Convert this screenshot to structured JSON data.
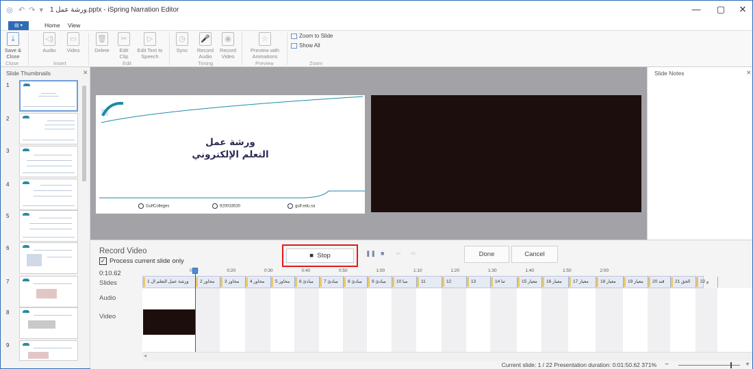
{
  "window": {
    "file_name": "ورشة عمل 1.pptx",
    "separator": "-",
    "app_name": "iSpring Narration Editor"
  },
  "ribbon_tabs": [
    "Home",
    "View"
  ],
  "ribbon": {
    "buttons": [
      {
        "label": "Save & Close",
        "icon": "save-close-icon"
      },
      {
        "label": "Audio",
        "icon": "audio-icon"
      },
      {
        "label": "Video",
        "icon": "video-icon"
      },
      {
        "label": "Delete",
        "icon": "delete-icon"
      },
      {
        "label": "Edit Clip",
        "icon": "edit-clip-icon"
      },
      {
        "label": "Edit Text to Speech",
        "icon": "text-to-speech-icon"
      },
      {
        "label": "Sync",
        "icon": "sync-icon"
      },
      {
        "label": "Record Audio",
        "icon": "record-audio-icon"
      },
      {
        "label": "Record Video",
        "icon": "record-video-icon"
      },
      {
        "label": "Preview with Animations",
        "icon": "preview-icon"
      }
    ],
    "groups": [
      "Close",
      "Insert",
      "Edit",
      "Timing",
      "Preview",
      "Zoom"
    ],
    "zoom_to_slide": "Zoom to Slide",
    "show_all": "Show All"
  },
  "thumbnails": {
    "header": "Slide Thumbnails",
    "numbers": [
      "1",
      "2",
      "3",
      "4",
      "5",
      "6",
      "7",
      "8",
      "9"
    ]
  },
  "slide": {
    "title_line1": "ورشة عمل",
    "title_line2": "التعلم الإلكتروني",
    "footer_social": "GulfColleges",
    "footer_phone": "920033530",
    "footer_web": "gulf.edu.sa"
  },
  "notes": {
    "header": "Slide Notes"
  },
  "record": {
    "title": "Record Video",
    "process_label": "Process current slide only",
    "process_checked": true,
    "stop_label": "Stop",
    "done_label": "Done",
    "cancel_label": "Cancel",
    "time": "0:10.62",
    "row_slides": "Slides",
    "row_audio": "Audio",
    "row_video": "Video"
  },
  "ruler_ticks": [
    "0:10",
    "0:20",
    "0:30",
    "0:40",
    "0:50",
    "1:00",
    "1:10",
    "1:20",
    "1:30",
    "1:40",
    "1:50",
    "2:00"
  ],
  "slide_segments": [
    "1 ورشة عمل التعلم ال",
    "2 محاور",
    "3 محاور",
    "4 محاور",
    "5 محاور",
    "6 مبادئ",
    "7 مبادئ",
    "8 مبادئ",
    "9 مبادئ",
    "10 مبا",
    "11",
    "12",
    "13",
    "14 تنا",
    "15 معيار",
    "16 معيار",
    "17 معيار",
    "18 معيار",
    "19 معيار",
    "20 قند",
    "21 الحق",
    "22 و"
  ],
  "status": {
    "text": "Current slide: 1 / 22   Presentation duration: 0:01:50.62   371%",
    "minus": "−",
    "plus": "+"
  }
}
